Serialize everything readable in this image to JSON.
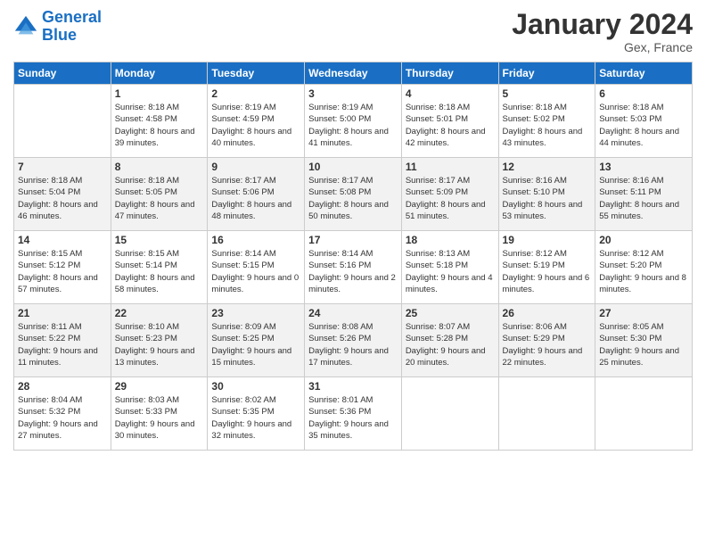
{
  "header": {
    "logo_line1": "General",
    "logo_line2": "Blue",
    "month": "January 2024",
    "location": "Gex, France"
  },
  "days_of_week": [
    "Sunday",
    "Monday",
    "Tuesday",
    "Wednesday",
    "Thursday",
    "Friday",
    "Saturday"
  ],
  "weeks": [
    [
      {
        "date": "",
        "sunrise": "",
        "sunset": "",
        "daylight": ""
      },
      {
        "date": "1",
        "sunrise": "Sunrise: 8:18 AM",
        "sunset": "Sunset: 4:58 PM",
        "daylight": "Daylight: 8 hours and 39 minutes."
      },
      {
        "date": "2",
        "sunrise": "Sunrise: 8:19 AM",
        "sunset": "Sunset: 4:59 PM",
        "daylight": "Daylight: 8 hours and 40 minutes."
      },
      {
        "date": "3",
        "sunrise": "Sunrise: 8:19 AM",
        "sunset": "Sunset: 5:00 PM",
        "daylight": "Daylight: 8 hours and 41 minutes."
      },
      {
        "date": "4",
        "sunrise": "Sunrise: 8:18 AM",
        "sunset": "Sunset: 5:01 PM",
        "daylight": "Daylight: 8 hours and 42 minutes."
      },
      {
        "date": "5",
        "sunrise": "Sunrise: 8:18 AM",
        "sunset": "Sunset: 5:02 PM",
        "daylight": "Daylight: 8 hours and 43 minutes."
      },
      {
        "date": "6",
        "sunrise": "Sunrise: 8:18 AM",
        "sunset": "Sunset: 5:03 PM",
        "daylight": "Daylight: 8 hours and 44 minutes."
      }
    ],
    [
      {
        "date": "7",
        "sunrise": "Sunrise: 8:18 AM",
        "sunset": "Sunset: 5:04 PM",
        "daylight": "Daylight: 8 hours and 46 minutes."
      },
      {
        "date": "8",
        "sunrise": "Sunrise: 8:18 AM",
        "sunset": "Sunset: 5:05 PM",
        "daylight": "Daylight: 8 hours and 47 minutes."
      },
      {
        "date": "9",
        "sunrise": "Sunrise: 8:17 AM",
        "sunset": "Sunset: 5:06 PM",
        "daylight": "Daylight: 8 hours and 48 minutes."
      },
      {
        "date": "10",
        "sunrise": "Sunrise: 8:17 AM",
        "sunset": "Sunset: 5:08 PM",
        "daylight": "Daylight: 8 hours and 50 minutes."
      },
      {
        "date": "11",
        "sunrise": "Sunrise: 8:17 AM",
        "sunset": "Sunset: 5:09 PM",
        "daylight": "Daylight: 8 hours and 51 minutes."
      },
      {
        "date": "12",
        "sunrise": "Sunrise: 8:16 AM",
        "sunset": "Sunset: 5:10 PM",
        "daylight": "Daylight: 8 hours and 53 minutes."
      },
      {
        "date": "13",
        "sunrise": "Sunrise: 8:16 AM",
        "sunset": "Sunset: 5:11 PM",
        "daylight": "Daylight: 8 hours and 55 minutes."
      }
    ],
    [
      {
        "date": "14",
        "sunrise": "Sunrise: 8:15 AM",
        "sunset": "Sunset: 5:12 PM",
        "daylight": "Daylight: 8 hours and 57 minutes."
      },
      {
        "date": "15",
        "sunrise": "Sunrise: 8:15 AM",
        "sunset": "Sunset: 5:14 PM",
        "daylight": "Daylight: 8 hours and 58 minutes."
      },
      {
        "date": "16",
        "sunrise": "Sunrise: 8:14 AM",
        "sunset": "Sunset: 5:15 PM",
        "daylight": "Daylight: 9 hours and 0 minutes."
      },
      {
        "date": "17",
        "sunrise": "Sunrise: 8:14 AM",
        "sunset": "Sunset: 5:16 PM",
        "daylight": "Daylight: 9 hours and 2 minutes."
      },
      {
        "date": "18",
        "sunrise": "Sunrise: 8:13 AM",
        "sunset": "Sunset: 5:18 PM",
        "daylight": "Daylight: 9 hours and 4 minutes."
      },
      {
        "date": "19",
        "sunrise": "Sunrise: 8:12 AM",
        "sunset": "Sunset: 5:19 PM",
        "daylight": "Daylight: 9 hours and 6 minutes."
      },
      {
        "date": "20",
        "sunrise": "Sunrise: 8:12 AM",
        "sunset": "Sunset: 5:20 PM",
        "daylight": "Daylight: 9 hours and 8 minutes."
      }
    ],
    [
      {
        "date": "21",
        "sunrise": "Sunrise: 8:11 AM",
        "sunset": "Sunset: 5:22 PM",
        "daylight": "Daylight: 9 hours and 11 minutes."
      },
      {
        "date": "22",
        "sunrise": "Sunrise: 8:10 AM",
        "sunset": "Sunset: 5:23 PM",
        "daylight": "Daylight: 9 hours and 13 minutes."
      },
      {
        "date": "23",
        "sunrise": "Sunrise: 8:09 AM",
        "sunset": "Sunset: 5:25 PM",
        "daylight": "Daylight: 9 hours and 15 minutes."
      },
      {
        "date": "24",
        "sunrise": "Sunrise: 8:08 AM",
        "sunset": "Sunset: 5:26 PM",
        "daylight": "Daylight: 9 hours and 17 minutes."
      },
      {
        "date": "25",
        "sunrise": "Sunrise: 8:07 AM",
        "sunset": "Sunset: 5:28 PM",
        "daylight": "Daylight: 9 hours and 20 minutes."
      },
      {
        "date": "26",
        "sunrise": "Sunrise: 8:06 AM",
        "sunset": "Sunset: 5:29 PM",
        "daylight": "Daylight: 9 hours and 22 minutes."
      },
      {
        "date": "27",
        "sunrise": "Sunrise: 8:05 AM",
        "sunset": "Sunset: 5:30 PM",
        "daylight": "Daylight: 9 hours and 25 minutes."
      }
    ],
    [
      {
        "date": "28",
        "sunrise": "Sunrise: 8:04 AM",
        "sunset": "Sunset: 5:32 PM",
        "daylight": "Daylight: 9 hours and 27 minutes."
      },
      {
        "date": "29",
        "sunrise": "Sunrise: 8:03 AM",
        "sunset": "Sunset: 5:33 PM",
        "daylight": "Daylight: 9 hours and 30 minutes."
      },
      {
        "date": "30",
        "sunrise": "Sunrise: 8:02 AM",
        "sunset": "Sunset: 5:35 PM",
        "daylight": "Daylight: 9 hours and 32 minutes."
      },
      {
        "date": "31",
        "sunrise": "Sunrise: 8:01 AM",
        "sunset": "Sunset: 5:36 PM",
        "daylight": "Daylight: 9 hours and 35 minutes."
      },
      {
        "date": "",
        "sunrise": "",
        "sunset": "",
        "daylight": ""
      },
      {
        "date": "",
        "sunrise": "",
        "sunset": "",
        "daylight": ""
      },
      {
        "date": "",
        "sunrise": "",
        "sunset": "",
        "daylight": ""
      }
    ]
  ]
}
